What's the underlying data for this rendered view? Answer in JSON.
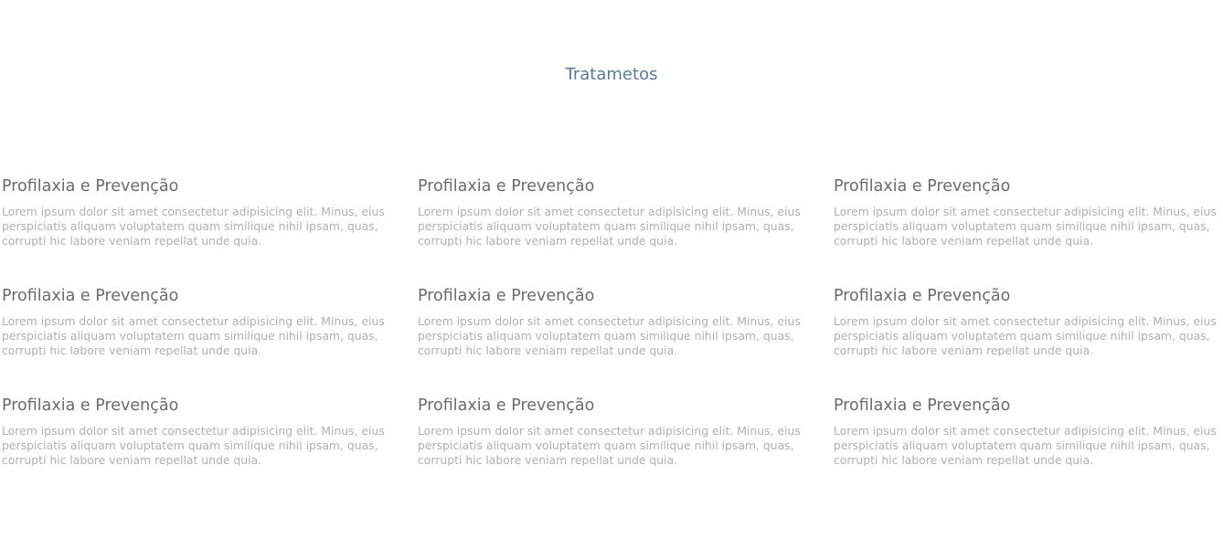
{
  "section": {
    "title": "Tratametos"
  },
  "cards": [
    {
      "title": "Profilaxia e Prevenção",
      "text": "Lorem ipsum dolor sit amet consectetur adipisicing elit. Minus, eius perspiciatis aliquam voluptatem quam similique nihil ipsam, quas, corrupti hic labore veniam repellat unde quia."
    },
    {
      "title": "Profilaxia e Prevenção",
      "text": "Lorem ipsum dolor sit amet consectetur adipisicing elit. Minus, eius perspiciatis aliquam voluptatem quam similique nihil ipsam, quas, corrupti hic labore veniam repellat unde quia."
    },
    {
      "title": "Profilaxia e Prevenção",
      "text": "Lorem ipsum dolor sit amet consectetur adipisicing elit. Minus, eius perspiciatis aliquam voluptatem quam similique nihil ipsam, quas, corrupti hic labore veniam repellat unde quia."
    },
    {
      "title": "Profilaxia e Prevenção",
      "text": "Lorem ipsum dolor sit amet consectetur adipisicing elit. Minus, eius perspiciatis aliquam voluptatem quam similique nihil ipsam, quas, corrupti hic labore veniam repellat unde quia."
    },
    {
      "title": "Profilaxia e Prevenção",
      "text": "Lorem ipsum dolor sit amet consectetur adipisicing elit. Minus, eius perspiciatis aliquam voluptatem quam similique nihil ipsam, quas, corrupti hic labore veniam repellat unde quia."
    },
    {
      "title": "Profilaxia e Prevenção",
      "text": "Lorem ipsum dolor sit amet consectetur adipisicing elit. Minus, eius perspiciatis aliquam voluptatem quam similique nihil ipsam, quas, corrupti hic labore veniam repellat unde quia."
    },
    {
      "title": "Profilaxia e Prevenção",
      "text": "Lorem ipsum dolor sit amet consectetur adipisicing elit. Minus, eius perspiciatis aliquam voluptatem quam similique nihil ipsam, quas, corrupti hic labore veniam repellat unde quia."
    },
    {
      "title": "Profilaxia e Prevenção",
      "text": "Lorem ipsum dolor sit amet consectetur adipisicing elit. Minus, eius perspiciatis aliquam voluptatem quam similique nihil ipsam, quas, corrupti hic labore veniam repellat unde quia."
    },
    {
      "title": "Profilaxia e Prevenção",
      "text": "Lorem ipsum dolor sit amet consectetur adipisicing elit. Minus, eius perspiciatis aliquam voluptatem quam similique nihil ipsam, quas, corrupti hic labore veniam repellat unde quia."
    }
  ],
  "colors": {
    "section_title": "#5a7a95",
    "card_title": "#6b6b6b",
    "card_text": "#b0b0b0",
    "background": "#ffffff"
  }
}
